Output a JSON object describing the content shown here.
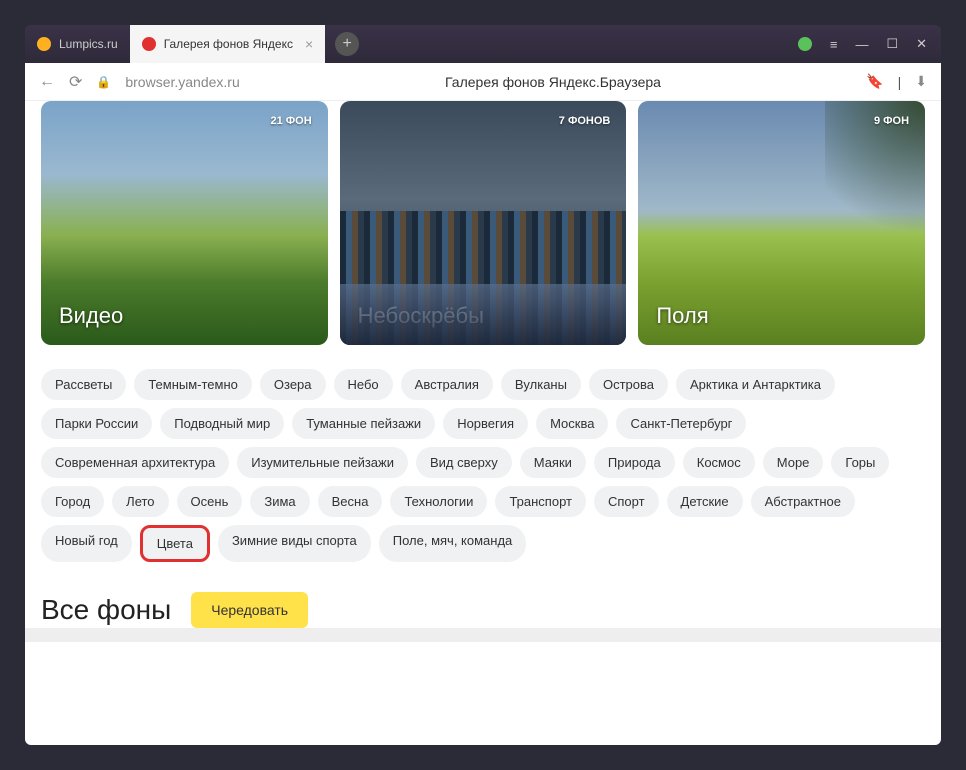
{
  "tabs": [
    {
      "label": "Lumpics.ru"
    },
    {
      "label": "Галерея фонов Яндекс"
    }
  ],
  "url": "browser.yandex.ru",
  "page_title": "Галерея фонов Яндекс.Браузера",
  "cards": [
    {
      "title": "Видео",
      "badge": "21 ФОН"
    },
    {
      "title": "Небоскрёбы",
      "badge": "7 ФОНОВ"
    },
    {
      "title": "Поля",
      "badge": "9 ФОН"
    }
  ],
  "tags": [
    "Рассветы",
    "Темным-темно",
    "Озера",
    "Небо",
    "Австралия",
    "Вулканы",
    "Острова",
    "Арктика и Антарктика",
    "Парки России",
    "Подводный мир",
    "Туманные пейзажи",
    "Норвегия",
    "Москва",
    "Санкт-Петербург",
    "Современная архитектура",
    "Изумительные пейзажи",
    "Вид сверху",
    "Маяки",
    "Природа",
    "Космос",
    "Море",
    "Горы",
    "Город",
    "Лето",
    "Осень",
    "Зима",
    "Весна",
    "Технологии",
    "Транспорт",
    "Спорт",
    "Детские",
    "Абстрактное",
    "Новый год",
    "Цвета",
    "Зимние виды спорта",
    "Поле, мяч, команда"
  ],
  "highlighted_tag": "Цвета",
  "all_backgrounds": "Все фоны",
  "shuffle": "Чередовать"
}
